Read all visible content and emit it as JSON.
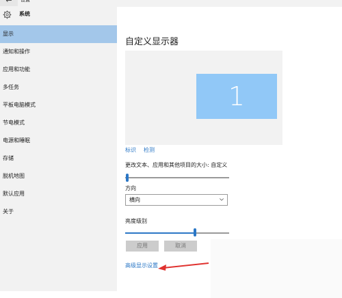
{
  "window": {
    "back_icon": "←",
    "title": "设置"
  },
  "sidebar": {
    "header_title": "系统",
    "items": [
      {
        "label": "显示",
        "active": true
      },
      {
        "label": "通知和操作"
      },
      {
        "label": "应用和功能"
      },
      {
        "label": "多任务"
      },
      {
        "label": "平板电脑模式"
      },
      {
        "label": "节电模式"
      },
      {
        "label": "电源和睡眠"
      },
      {
        "label": "存储"
      },
      {
        "label": "脱机地图"
      },
      {
        "label": "默认应用"
      },
      {
        "label": "关于"
      }
    ]
  },
  "main": {
    "title": "自定义显示器",
    "monitor_number": "1",
    "identify_label": "标识",
    "detect_label": "检测",
    "size_label": "更改文本、应用和其他项目的大小: 自定义",
    "size_level": 0.0,
    "orientation_label": "方向",
    "orientation_value": "横向",
    "brightness_label": "亮度级别",
    "brightness_level": 0.67,
    "apply_label": "应用",
    "cancel_label": "取消",
    "advanced_label": "高级显示设置"
  },
  "colors": {
    "accent": "#2b77c6",
    "sidebar_active": "#a3c7ea",
    "monitor_tile": "#91c8f7",
    "annotation_arrow": "#e0322f"
  }
}
